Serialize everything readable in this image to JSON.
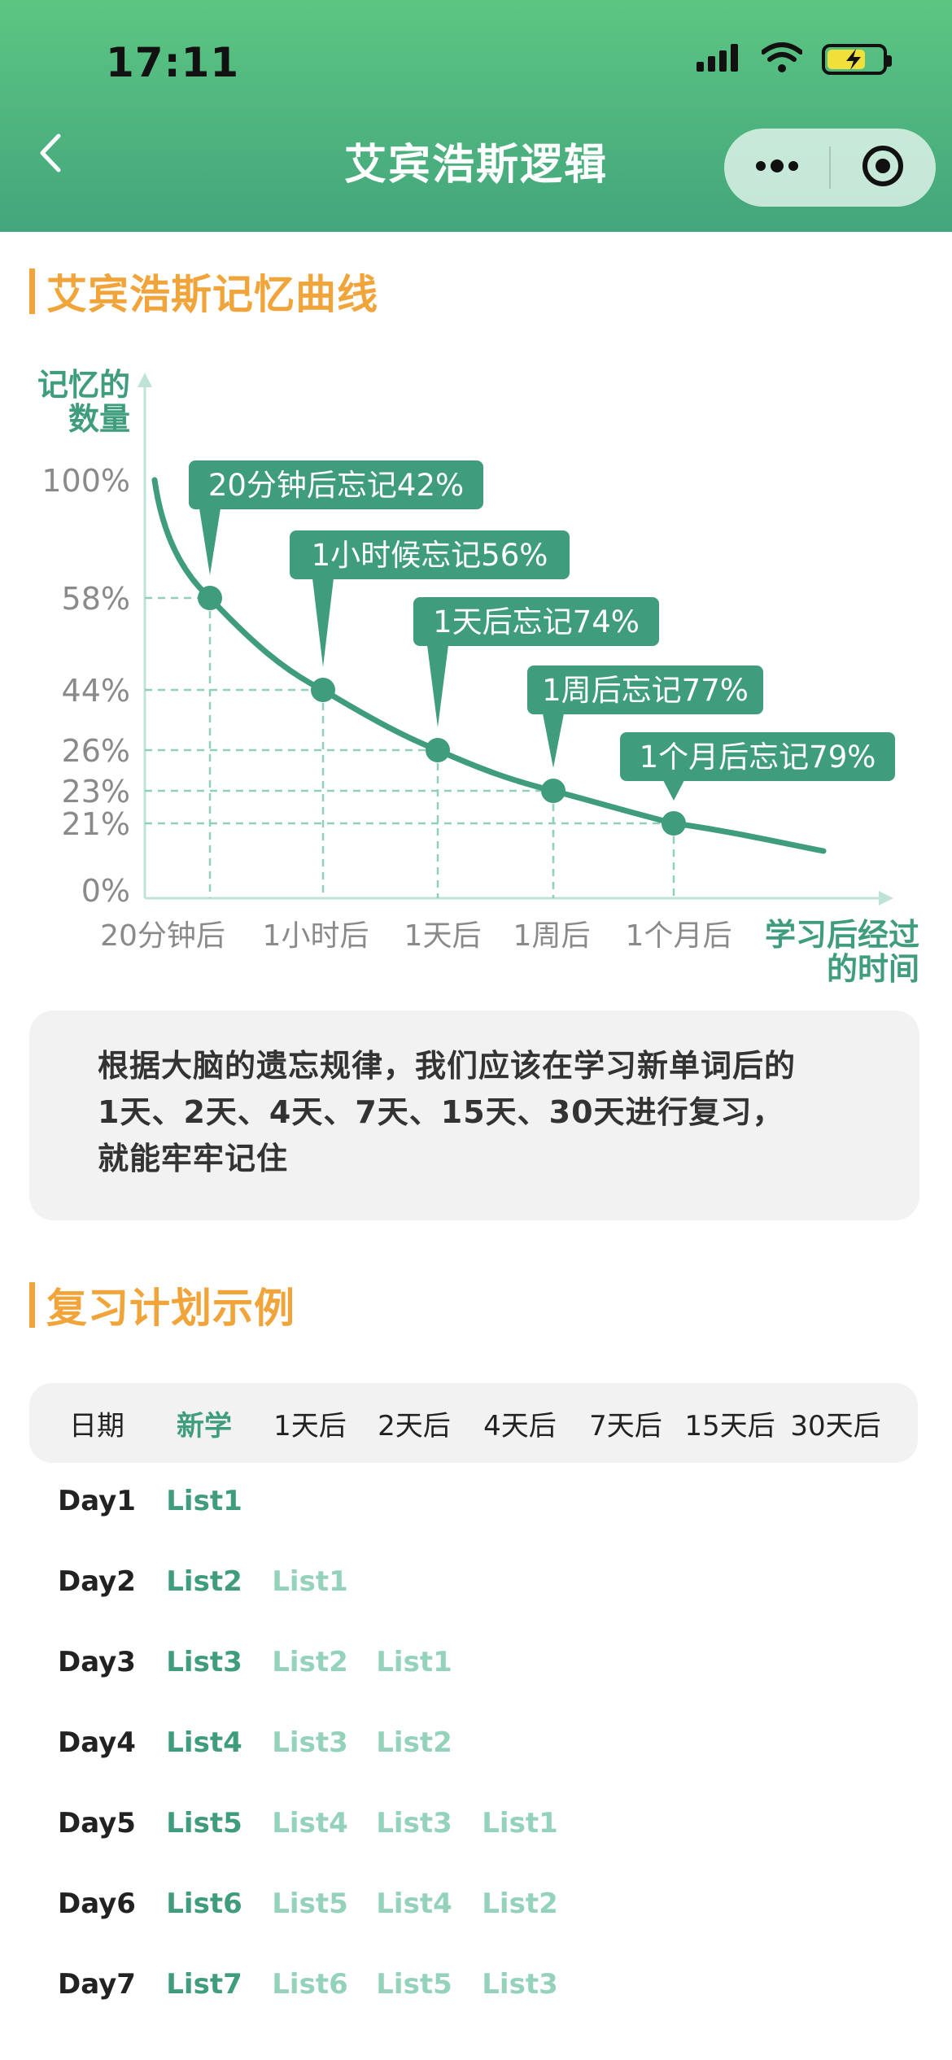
{
  "status_bar": {
    "time": "17:11",
    "icons": [
      "signal-icon",
      "wifi-icon",
      "battery-charging-icon"
    ],
    "battery_level": 0.7
  },
  "nav": {
    "title": "艾宾浩斯逻辑",
    "back_icon": "chevron-left-icon",
    "more_icon": "more-dots-icon",
    "close_icon": "target-circle-icon"
  },
  "section1": {
    "title": "艾宾浩斯记忆曲线"
  },
  "chart_data": {
    "type": "line",
    "ylabel_lines": [
      "记忆的",
      "数量"
    ],
    "xlabel_lines": [
      "学习后经过",
      "的时间"
    ],
    "y_ticks": [
      "100%",
      "58%",
      "44%",
      "26%",
      "23%",
      "21%",
      "0%"
    ],
    "categories": [
      "20分钟后",
      "1小时后",
      "1天后",
      "1周后",
      "1个月后"
    ],
    "values": [
      58,
      44,
      26,
      23,
      21
    ],
    "start_value": 100,
    "annotations": [
      "20分钟后忘记42%",
      "1小时候忘记56%",
      "1天后忘记74%",
      "1周后忘记77%",
      "1个月后忘记79%"
    ],
    "grid": "dashed-guides",
    "colors": {
      "curve": "#3f9c7c",
      "callout": "#3f9c7c",
      "guide": "#8fd0b7",
      "axis": "#bfe3d6",
      "tick_text": "#8a8a8a",
      "axis_label": "#3f9c7c"
    }
  },
  "note": {
    "lines": [
      "根据大脑的遗忘规律，我们应该在学习新单词后的",
      "1天、2天、4天、7天、15天、30天进行复习，",
      "就能牢牢记住"
    ]
  },
  "section2": {
    "title": "复习计划示例"
  },
  "schedule": {
    "headers": [
      "日期",
      "新学",
      "1天后",
      "2天后",
      "4天后",
      "7天后",
      "15天后",
      "30天后"
    ],
    "rows": [
      {
        "day": "Day1",
        "cells": [
          "List1"
        ]
      },
      {
        "day": "Day2",
        "cells": [
          "List2",
          "List1"
        ]
      },
      {
        "day": "Day3",
        "cells": [
          "List3",
          "List2",
          "List1"
        ]
      },
      {
        "day": "Day4",
        "cells": [
          "List4",
          "List3",
          "List2"
        ]
      },
      {
        "day": "Day5",
        "cells": [
          "List5",
          "List4",
          "List3",
          "List1"
        ]
      },
      {
        "day": "Day6",
        "cells": [
          "List6",
          "List5",
          "List4",
          "List2"
        ]
      },
      {
        "day": "Day7",
        "cells": [
          "List7",
          "List6",
          "List5",
          "List3"
        ]
      }
    ]
  },
  "colors": {
    "header_top": "#5cc682",
    "header_bottom": "#43a57c",
    "accent_orange": "#f0a43a",
    "accent_green": "#3f9c7c",
    "review_green": "#95d2bb"
  }
}
